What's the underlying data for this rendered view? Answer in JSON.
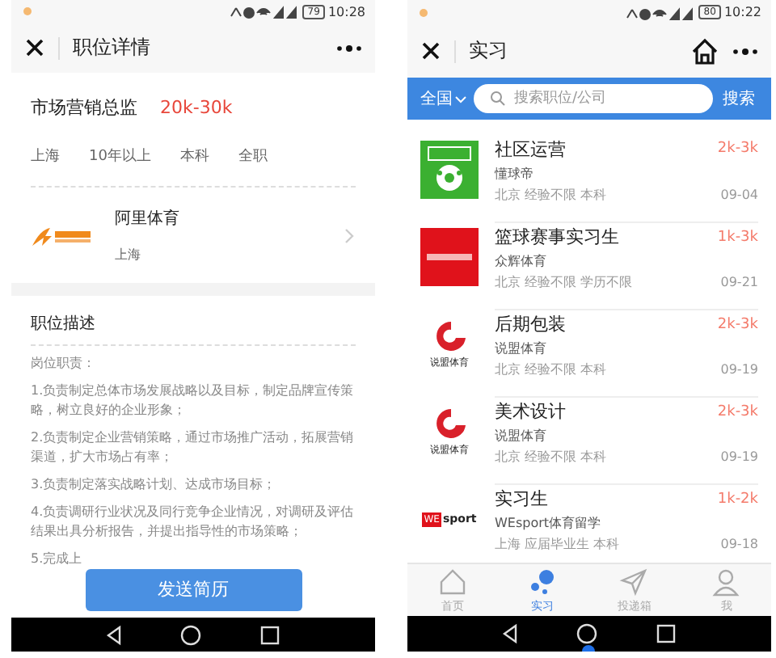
{
  "job_detail": {
    "status_bar": {
      "battery": "79",
      "time": "10:28"
    },
    "header": {
      "title": "职位详情"
    },
    "job": {
      "title": "市场营销总监",
      "salary": "20k-30k",
      "tags": [
        "上海",
        "10年以上",
        "本科",
        "全职"
      ]
    },
    "company": {
      "name": "阿里体育",
      "city": "上海"
    },
    "description": {
      "heading": "职位描述",
      "lines": [
        "岗位职责：",
        "1.负责制定总体市场发展战略以及目标，制定品牌宣传策略，树立良好的企业形象；",
        "2.负责制定企业营销策略，通过市场推广活动，拓展营销渠道，扩大市场占有率；",
        "3.负责制定落实战略计划、达成市场目标；",
        "4.负责调研行业状况及同行竞争企业情况，对调研及评估结果出具分析报告，并提出指导性的市场策略；",
        "5.完成上"
      ]
    },
    "action_button": "发送简历"
  },
  "internship_list": {
    "status_bar": {
      "battery": "80",
      "time": "10:22"
    },
    "header": {
      "title": "实习"
    },
    "search": {
      "region": "全国",
      "placeholder": "搜索职位/公司",
      "button": "搜索"
    },
    "jobs": [
      {
        "logo": {
          "kind": "ball"
        },
        "title": "社区运营",
        "company": "懂球帝",
        "meta": "北京 经验不限 本科",
        "salary": "2k-3k",
        "date": "09-04"
      },
      {
        "logo": {
          "kind": "red"
        },
        "title": "篮球赛事实习生",
        "company": "众辉体育",
        "meta": "北京 经验不限 学历不限",
        "salary": "1k-3k",
        "date": "09-21"
      },
      {
        "logo": {
          "kind": "ring",
          "text": "说盟体育"
        },
        "title": "后期包装",
        "company": "说盟体育",
        "meta": "北京 经验不限 本科",
        "salary": "2k-3k",
        "date": "09-19"
      },
      {
        "logo": {
          "kind": "ring",
          "text": "说盟体育"
        },
        "title": "美术设计",
        "company": "说盟体育",
        "meta": "北京 经验不限 本科",
        "salary": "2k-3k",
        "date": "09-19"
      },
      {
        "logo": {
          "kind": "badge",
          "text": "WE",
          "text2": "sport"
        },
        "title": "实习生",
        "company": "WEsport体育留学",
        "meta": "上海 应届毕业生 本科",
        "salary": "1k-2k",
        "date": "09-18"
      }
    ],
    "tabs": [
      {
        "label": "首页",
        "kind": "home",
        "selected": false
      },
      {
        "label": "实习",
        "kind": "dots",
        "selected": true
      },
      {
        "label": "投递箱",
        "kind": "send",
        "selected": false
      },
      {
        "label": "我",
        "kind": "person",
        "selected": false
      }
    ]
  }
}
